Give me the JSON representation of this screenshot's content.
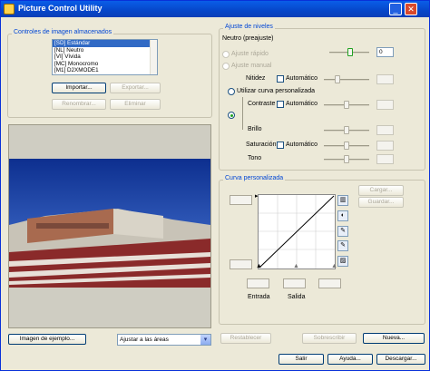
{
  "window": {
    "title": "Picture Control Utility",
    "buttons": {
      "minimize": "_",
      "close": "✕"
    }
  },
  "left": {
    "group_title": "Controles de imagen almacenados",
    "picture_controls": [
      "[SD] Estándar",
      "[NL] Neutro",
      "[VI] Vívida",
      "[MC] Monocromo",
      "[M1] D2XMODE1"
    ],
    "selected_index": 0,
    "import_label": "Importar...",
    "export_label": "Exportar...",
    "rename_label": "Renombrar...",
    "delete_label": "Eliminar",
    "sample_image_label": "Imagen de ejemplo...",
    "fit_option": "Ajustar a las áreas"
  },
  "levels": {
    "group_title": "Ajuste de niveles",
    "preset_label": "Neutro (preajuste)",
    "preset_value": "0",
    "quick_adjust_label": "Ajuste rápido",
    "manual_adjust_label": "Ajuste manual",
    "sharpening_label": "Nitidez",
    "auto_label": "Automático",
    "use_curve_label": "Utilizar curva personalizada",
    "contrast_label": "Contraste",
    "brightness_label": "Brillo",
    "saturation_label": "Saturación",
    "hue_label": "Tono"
  },
  "curve": {
    "group_title": "Curva personalizada",
    "load_label": "Cargar...",
    "save_label": "Guardar...",
    "input_label": "Entrada",
    "output_label": "Salida"
  },
  "bottom": {
    "restore_label": "Restablecer",
    "overwrite_label": "Sobrescribir",
    "new_label": "Nueva...",
    "exit_label": "Salir",
    "help_label": "Ayuda...",
    "download_label": "Descargar..."
  }
}
